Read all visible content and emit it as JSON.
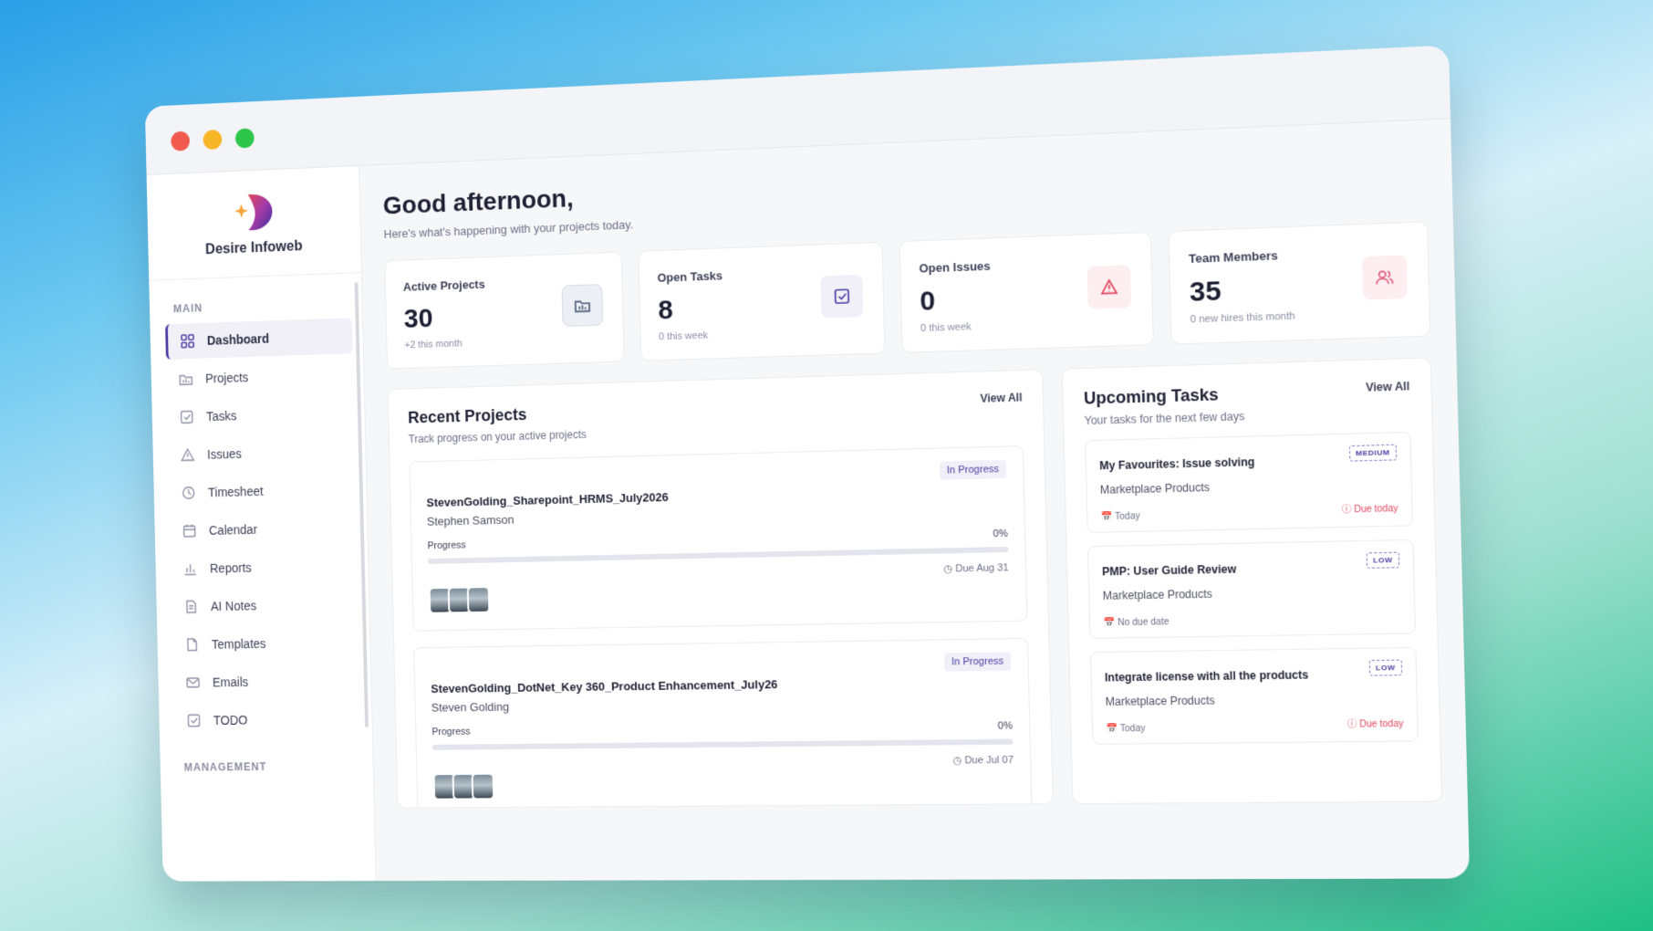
{
  "window": {
    "controls": [
      "close",
      "minimize",
      "maximize"
    ]
  },
  "brand": {
    "name": "Desire Infoweb"
  },
  "sidebar": {
    "main_label": "MAIN",
    "items": [
      {
        "label": "Dashboard",
        "icon": "grid-icon",
        "active": true
      },
      {
        "label": "Projects",
        "icon": "folder-icon"
      },
      {
        "label": "Tasks",
        "icon": "checkbox-icon"
      },
      {
        "label": "Issues",
        "icon": "warning-icon"
      },
      {
        "label": "Timesheet",
        "icon": "clock-icon"
      },
      {
        "label": "Calendar",
        "icon": "calendar-icon"
      },
      {
        "label": "Reports",
        "icon": "bar-chart-icon"
      },
      {
        "label": "AI Notes",
        "icon": "note-icon"
      },
      {
        "label": "Templates",
        "icon": "template-icon"
      },
      {
        "label": "Emails",
        "icon": "mail-icon"
      },
      {
        "label": "TODO",
        "icon": "checkbox-icon"
      }
    ],
    "management_label": "MANAGEMENT"
  },
  "header": {
    "greeting": "Good afternoon,",
    "subtitle": "Here's what's happening with your projects today."
  },
  "stats": [
    {
      "label": "Active Projects",
      "value": "30",
      "sub": "+2 this month",
      "icon": "folder-icon"
    },
    {
      "label": "Open Tasks",
      "value": "8",
      "sub": "0 this week",
      "icon": "checkbox-icon"
    },
    {
      "label": "Open Issues",
      "value": "0",
      "sub": "0 this week",
      "icon": "warning-icon"
    },
    {
      "label": "Team Members",
      "value": "35",
      "sub": "0 new hires this month",
      "icon": "users-icon"
    }
  ],
  "recent_projects": {
    "title": "Recent Projects",
    "subtitle": "Track progress on your active projects",
    "view_all": "View All",
    "progress_label": "Progress",
    "items": [
      {
        "name": "StevenGolding_Sharepoint_HRMS_July2026",
        "owner": "Stephen Samson",
        "status": "In Progress",
        "progress": "0%",
        "progress_value": 0,
        "due": "Due Aug 31"
      },
      {
        "name": "StevenGolding_DotNet_Key 360_Product Enhancement_July26",
        "owner": "Steven Golding",
        "status": "In Progress",
        "progress": "0%",
        "progress_value": 0,
        "due": "Due Jul 07"
      }
    ]
  },
  "upcoming_tasks": {
    "title": "Upcoming Tasks",
    "subtitle": "Your tasks for the next few days",
    "view_all": "View All",
    "items": [
      {
        "title": "My Favourites: Issue solving",
        "project": "Marketplace Products",
        "priority": "MEDIUM",
        "date": "Today",
        "due": "Due today"
      },
      {
        "title": "PMP: User Guide Review",
        "project": "Marketplace Products",
        "priority": "LOW",
        "date": "No due date",
        "due": ""
      },
      {
        "title": "Integrate license with all the products",
        "project": "Marketplace Products",
        "priority": "LOW",
        "date": "Today",
        "due": "Due today"
      }
    ]
  },
  "colors": {
    "accent": "#4b3fa3",
    "danger": "#e2475e",
    "close": "#f15b4f",
    "minimize": "#f7b627",
    "maximize": "#2ec64a"
  }
}
